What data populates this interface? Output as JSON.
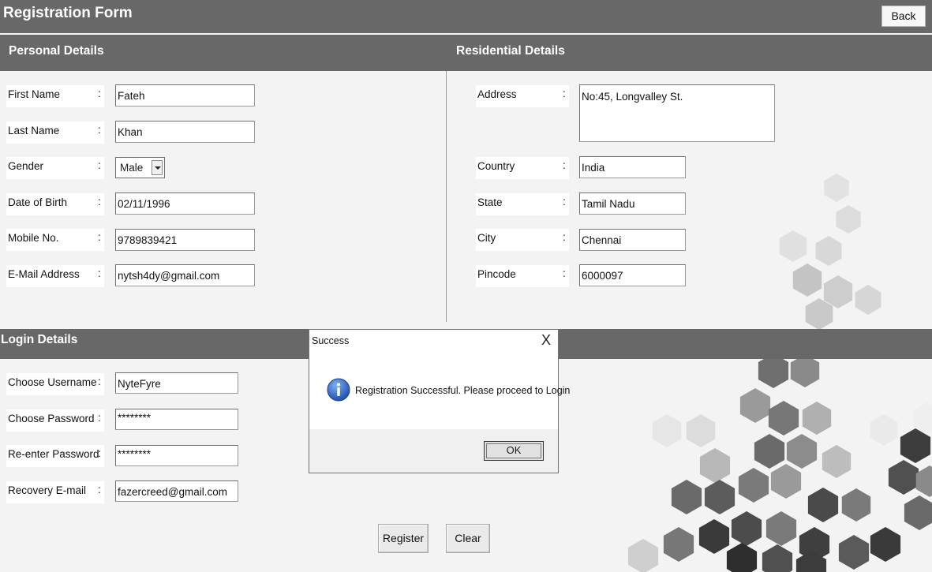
{
  "header": {
    "title": "Registration Form",
    "back_label": "Back"
  },
  "sections": {
    "personal": "Personal Details",
    "residential": "Residential Details",
    "login": "Login Details"
  },
  "colon": ":",
  "personal": {
    "first_name": {
      "label": "First Name",
      "value": "Fateh"
    },
    "last_name": {
      "label": "Last Name",
      "value": "Khan"
    },
    "gender": {
      "label": "Gender",
      "value": "Male"
    },
    "dob": {
      "label": "Date of Birth",
      "value": "02/11/1996"
    },
    "mobile": {
      "label": "Mobile No.",
      "value": "9789839421"
    },
    "email": {
      "label": "E-Mail Address",
      "value": "nytsh4dy@gmail.com"
    }
  },
  "residential": {
    "address": {
      "label": "Address",
      "value": "No:45, Longvalley  St."
    },
    "country": {
      "label": "Country",
      "value": "India"
    },
    "state": {
      "label": "State",
      "value": "Tamil Nadu"
    },
    "city": {
      "label": "City",
      "value": "Chennai"
    },
    "pincode": {
      "label": "Pincode",
      "value": "6000097"
    }
  },
  "login": {
    "username": {
      "label": "Choose Username",
      "value": "NyteFyre"
    },
    "password": {
      "label": "Choose Password",
      "value": "********"
    },
    "reenter": {
      "label": "Re-enter Password",
      "value": "********"
    },
    "recovery": {
      "label": "Recovery E-mail",
      "value": "fazercreed@gmail.com"
    }
  },
  "buttons": {
    "register": "Register",
    "clear": "Clear"
  },
  "dialog": {
    "title": "Success",
    "close": "X",
    "message": "Registration Successful. Please proceed to Login",
    "ok": "OK",
    "icon": "info-icon"
  },
  "colors": {
    "bar": "#686868",
    "background": "#f3f3f3",
    "dialog_border": "#3c7fb1",
    "info_blue": "#2a58b4"
  }
}
